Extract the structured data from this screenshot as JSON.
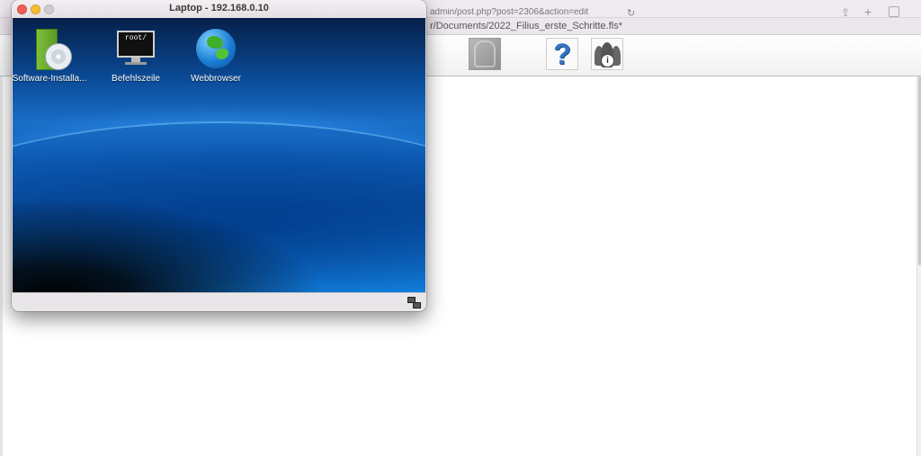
{
  "browser": {
    "url": "admin/post.php?post=2306&action=edit",
    "filius_title": "r/Documents/2022_Filius_erste_Schritte.fls*"
  },
  "laptop_window": {
    "title": "Laptop - 192.168.0.10",
    "desktop_icons": [
      {
        "label": "Software-Installa...",
        "icon": "software-install-icon"
      },
      {
        "label": "Befehlszeile",
        "icon": "terminal-icon",
        "screen_text": "root/"
      },
      {
        "label": "Webbrowser",
        "icon": "web-browser-globe-icon"
      }
    ]
  },
  "toolbar": {
    "help_glyph": "?",
    "info_glyph": "i"
  },
  "colors": {
    "close": "#ef5e57",
    "minimize": "#f5bd30",
    "desktop_blue": "#1486e6"
  }
}
